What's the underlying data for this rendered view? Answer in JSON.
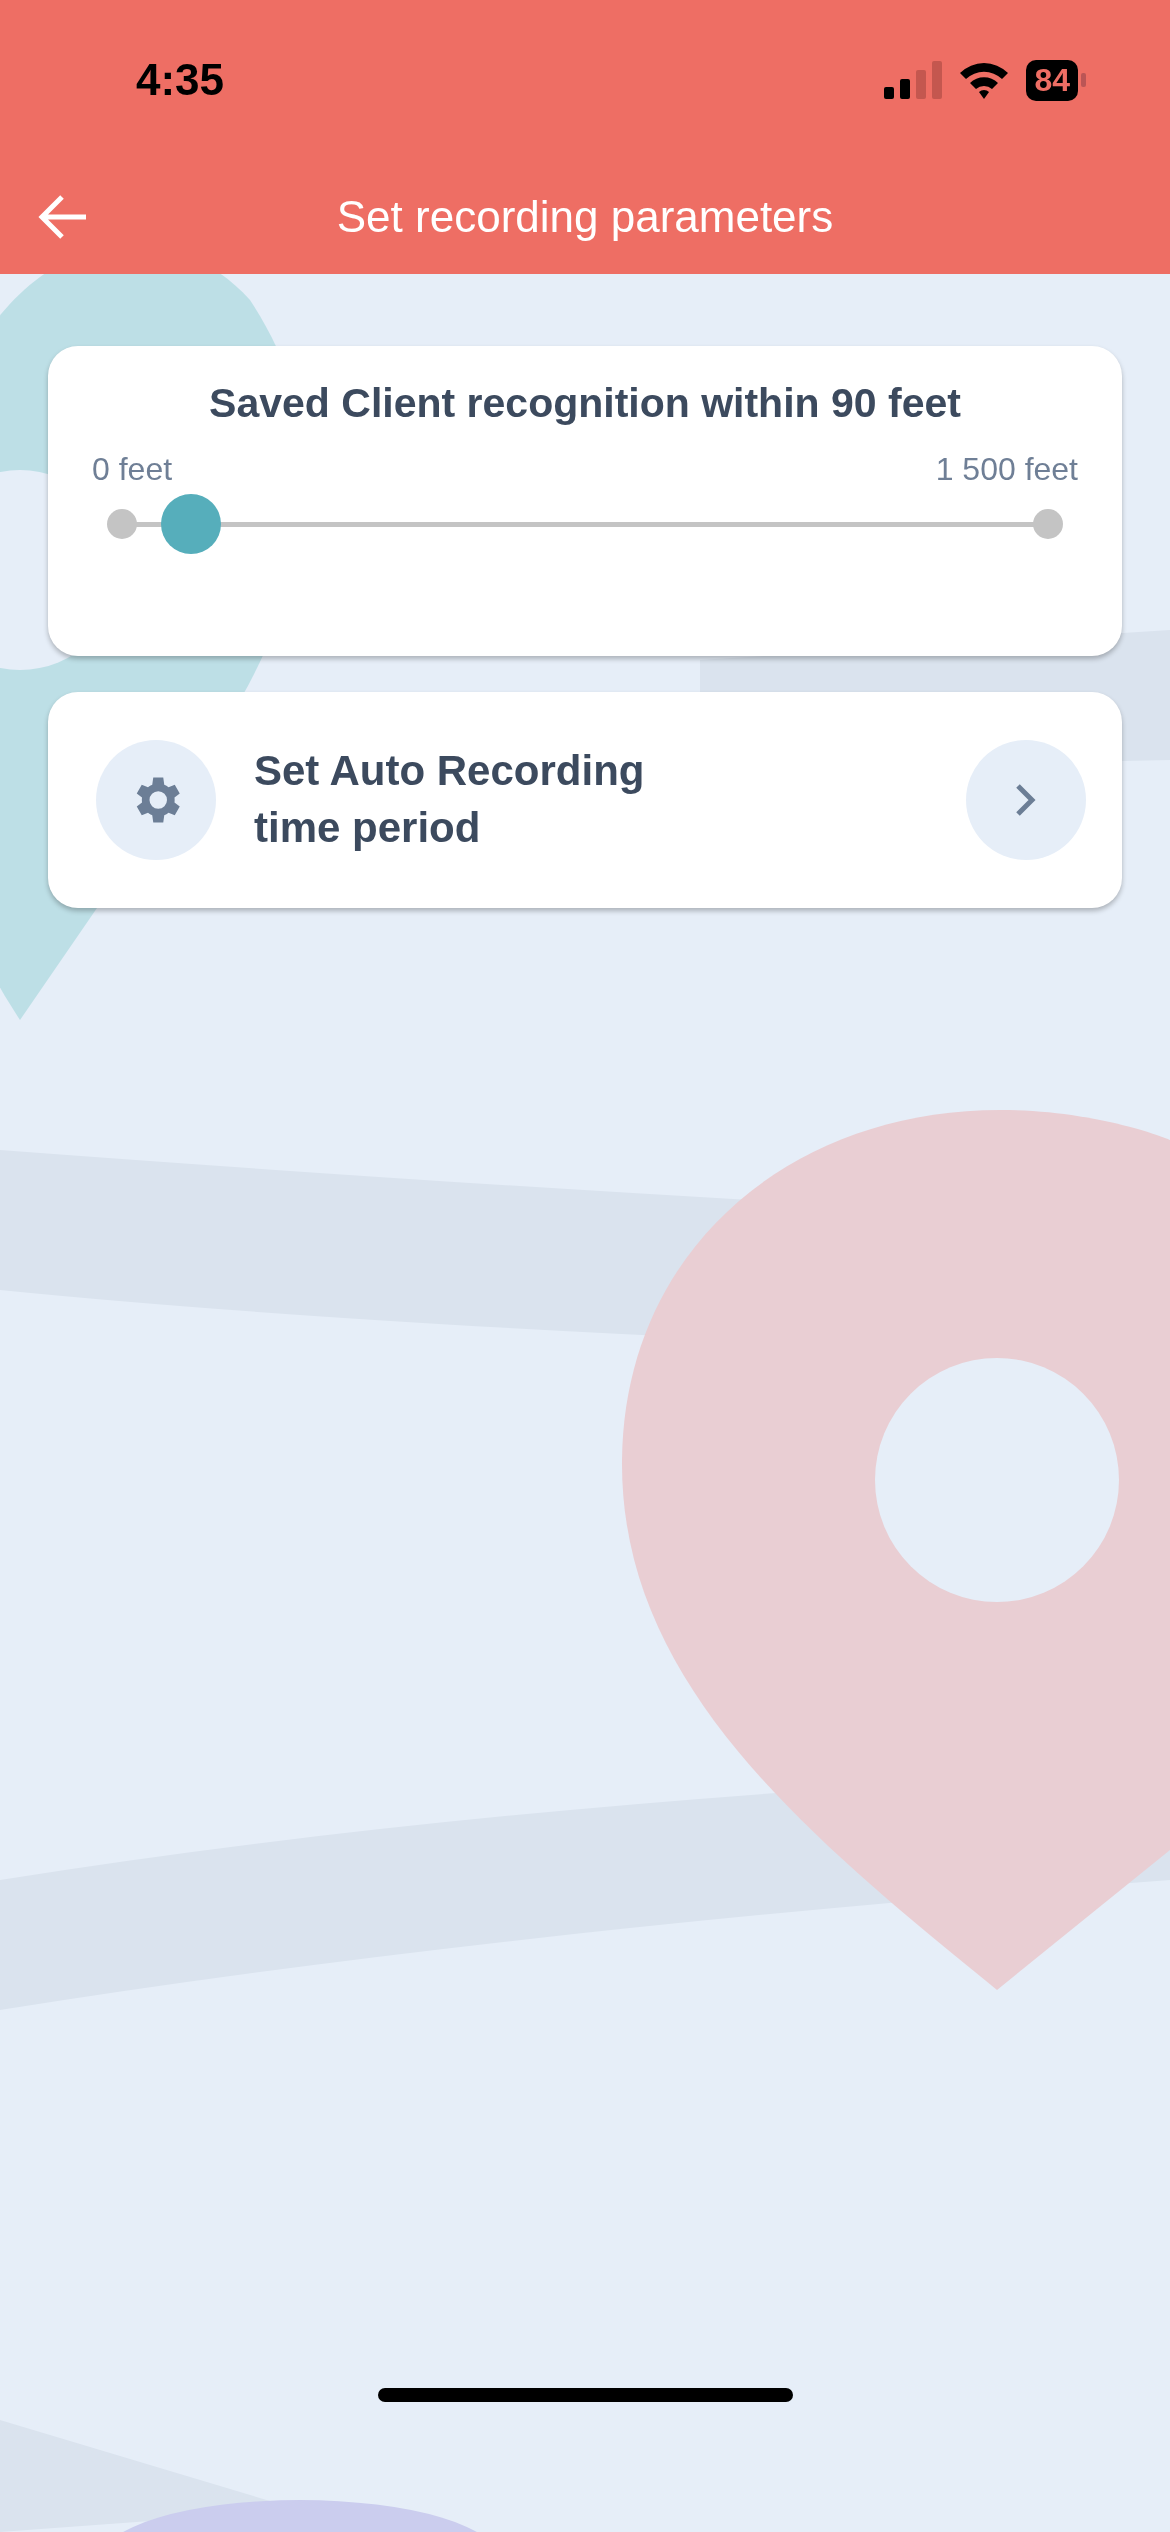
{
  "status_bar": {
    "time": "4:35",
    "battery": "84"
  },
  "header": {
    "title": "Set recording parameters"
  },
  "range_card": {
    "title": "Saved Client recognition within 90 feet",
    "min_label": "0 feet",
    "max_label": "1 500 feet",
    "level": 0.075
  },
  "menu_item": {
    "label": "Set Auto Recording\ntime period"
  }
}
